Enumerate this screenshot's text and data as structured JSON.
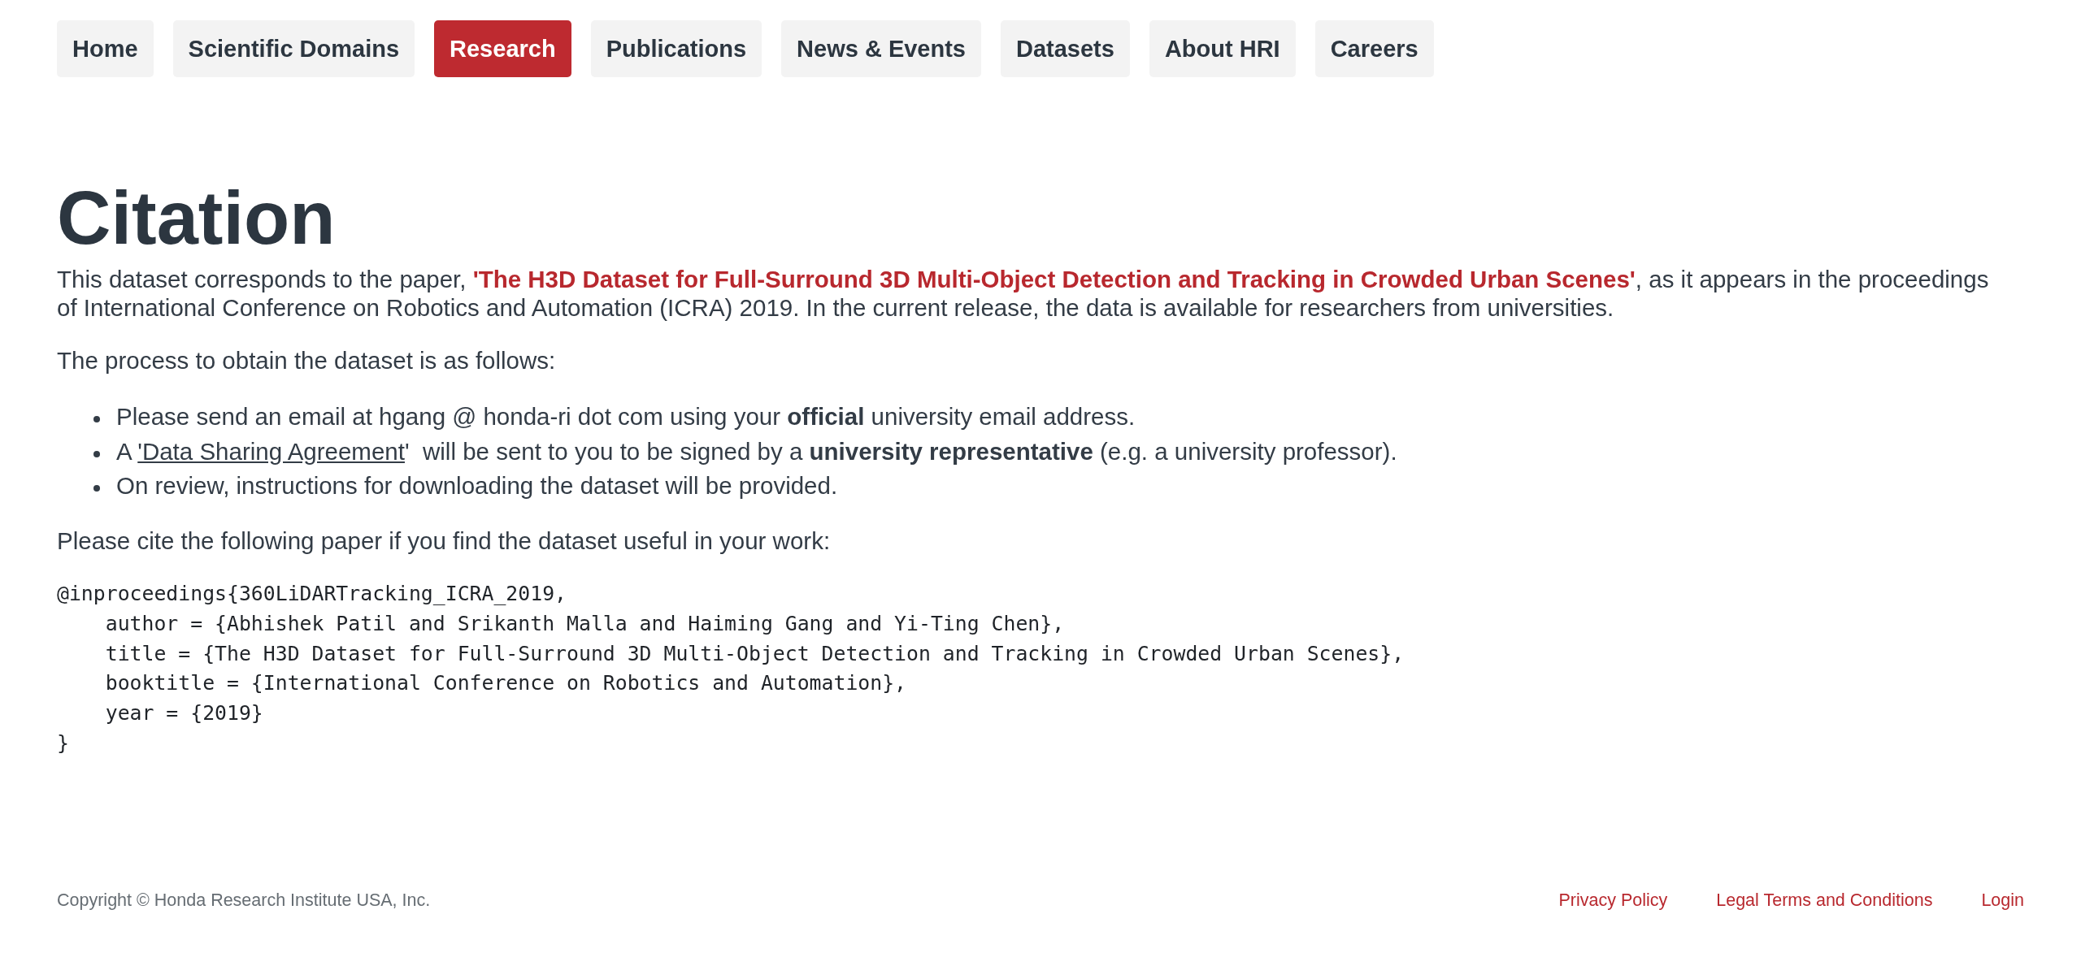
{
  "nav": {
    "tabs": [
      {
        "label": "Home",
        "selected": false
      },
      {
        "label": "Scientific Domains",
        "selected": false
      },
      {
        "label": "Research",
        "selected": true
      },
      {
        "label": "Publications",
        "selected": false
      },
      {
        "label": "News & Events",
        "selected": false
      },
      {
        "label": "Datasets",
        "selected": false
      },
      {
        "label": "About HRI",
        "selected": false
      },
      {
        "label": "Careers",
        "selected": false
      }
    ]
  },
  "title": "Citation",
  "intro": {
    "text": "This dataset corresponds to the paper, ",
    "link": "'The H3D Dataset for Full-Surround 3D Multi-Object Detection and Tracking in Crowded Urban Scenes'",
    "after": ", as it appears in the proceedings of International Conference on Robotics and Automation (ICRA) 2019. In the current release, the data is available for researchers from universities."
  },
  "process_intro": "The process to obtain the dataset is as follows:",
  "steps": [
    {
      "text": "Please send an email at hgang @ honda-ri dot com using your **official** university email address."
    },
    {
      "text": "A ",
      "link": "'Data Sharing Agreement",
      "after": "'  will be sent to you to be signed by a **university representative** (e.g. a university professor)."
    },
    {
      "text": "On review, instructions for downloading the dataset will be provided."
    }
  ],
  "cite_intro": "Please cite the following paper if you find the dataset useful in your work:",
  "citation_code": [
    "@inproceedings{360LiDARTracking_ICRA_2019,",
    "    author = {Abhishek Patil and Srikanth Malla and Haiming Gang and Yi-Ting Chen},",
    "    title = {The H3D Dataset for Full-Surround 3D Multi-Object Detection and Tracking in Crowded Urban Scenes},",
    "    booktitle = {International Conference on Robotics and Automation},",
    "    year = {2019}",
    "}"
  ],
  "footer": {
    "copyright": "Copyright © Honda Research Institute USA, Inc.",
    "links": [
      "Privacy Policy",
      "Legal Terms and Conditions",
      "Login"
    ]
  }
}
